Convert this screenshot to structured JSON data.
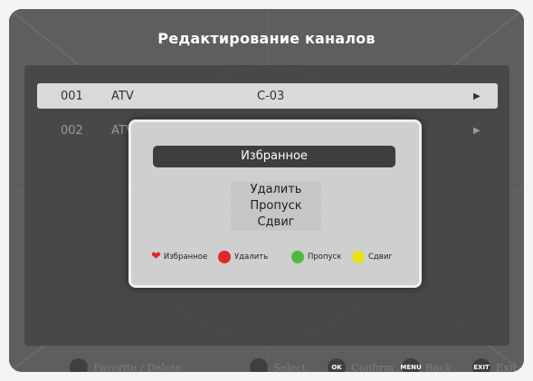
{
  "window": {
    "title": "Редактирование каналов"
  },
  "channels": [
    {
      "number": "001",
      "type": "ATV",
      "name": "C-03",
      "selected": true
    },
    {
      "number": "002",
      "type": "ATV",
      "name": "",
      "selected": false
    }
  ],
  "dialog": {
    "selected_option": "Избранное",
    "options": [
      "Удалить",
      "Пропуск",
      "Сдвиг"
    ],
    "legend": [
      {
        "label": "Избранное",
        "color": "#e0282c",
        "icon": "heart-icon"
      },
      {
        "label": "Удалить",
        "color": "#e0282c",
        "icon": "red-dot-icon"
      },
      {
        "label": "Пропуск",
        "color": "#4dbb3a",
        "icon": "green-dot-icon"
      },
      {
        "label": "Сдвиг",
        "color": "#e6e21a",
        "icon": "yellow-dot-icon"
      }
    ]
  },
  "footer": {
    "favorite_delete": "Favorite / Delete",
    "select": "Select",
    "ok_icon": "OK",
    "confirm": "Confirm",
    "menu_icon": "MENU",
    "back": "Back",
    "exit_icon": "EXIT",
    "exit": "Exit"
  },
  "arrow_glyph": "▶",
  "heart_glyph": "❤"
}
